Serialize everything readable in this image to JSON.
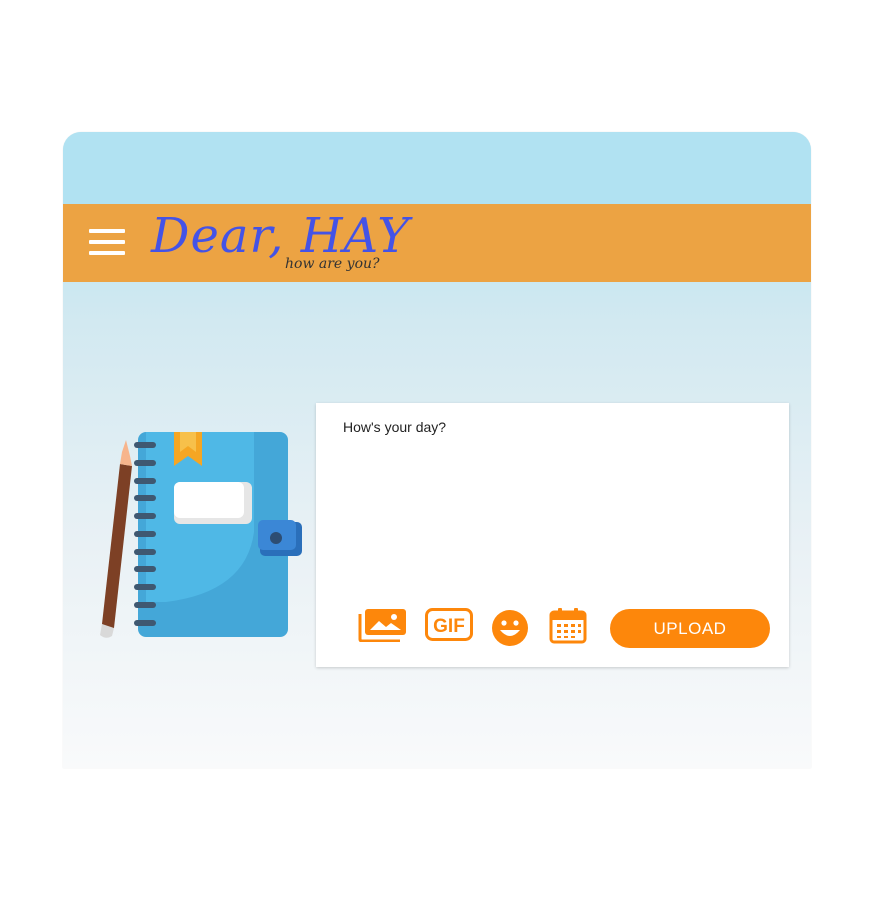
{
  "header": {
    "logo_title": "Dear, HAY",
    "logo_subtitle": "how are you?",
    "menu_icon": "hamburger-menu-icon"
  },
  "composer": {
    "placeholder": "How's your day?",
    "tools": [
      {
        "icon": "image-gallery-icon"
      },
      {
        "icon": "gif-icon",
        "label": "GIF"
      },
      {
        "icon": "emoji-smile-icon"
      },
      {
        "icon": "calendar-icon"
      }
    ],
    "upload_label": "UPLOAD"
  },
  "colors": {
    "header_bg": "#eca343",
    "logo_text": "#4453e6",
    "accent_orange": "#fd870b",
    "sky": "#b1e2f2"
  }
}
